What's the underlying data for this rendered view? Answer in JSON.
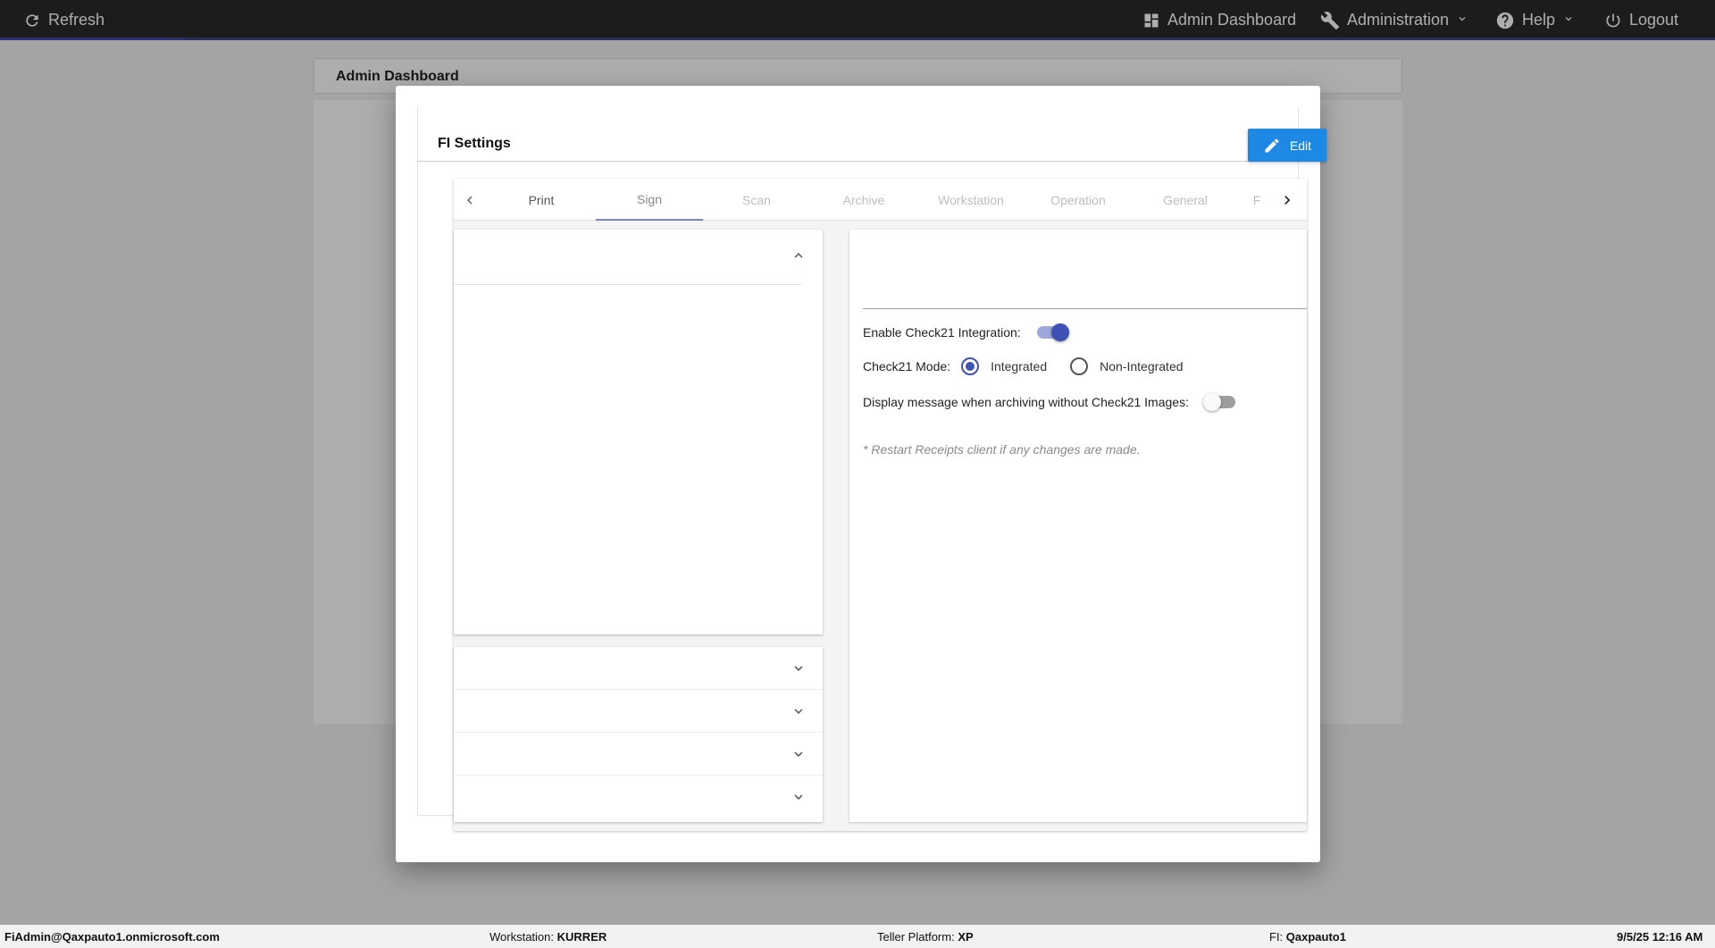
{
  "topbar": {
    "refresh_label": "Refresh",
    "admin_dashboard_label": "Admin Dashboard",
    "administration_label": "Administration",
    "help_label": "Help",
    "logout_label": "Logout"
  },
  "background": {
    "card_title": "Admin Dashboard"
  },
  "modal": {
    "title": "FI Settings",
    "edit_label": "Edit",
    "tabs": [
      {
        "label": "Print",
        "state": "enabled"
      },
      {
        "label": "Sign",
        "state": "active"
      },
      {
        "label": "Scan",
        "state": "disabled"
      },
      {
        "label": "Archive",
        "state": "disabled"
      },
      {
        "label": "Workstation",
        "state": "disabled"
      },
      {
        "label": "Operation",
        "state": "disabled"
      },
      {
        "label": "General",
        "state": "disabled"
      },
      {
        "label": "F",
        "state": "disabled"
      }
    ],
    "settings": {
      "enable_check21_label": "Enable Check21 Integration:",
      "enable_check21_value": true,
      "check21_mode_label": "Check21 Mode:",
      "mode_options": [
        "Integrated",
        "Non-Integrated"
      ],
      "mode_selected": "Integrated",
      "display_message_label": "Display message when archiving without Check21 Images:",
      "display_message_value": false,
      "restart_note": "* Restart Receipts client if any changes are made."
    }
  },
  "footer": {
    "user": "FiAdmin@Qaxpauto1.onmicrosoft.com",
    "workstation_label": "Workstation:",
    "workstation_value": "KURRER",
    "platform_label": "Teller Platform:",
    "platform_value": "XP",
    "fi_label": "FI:",
    "fi_value": "Qaxpauto1",
    "datetime": "9/5/25 12:16 AM"
  },
  "colors": {
    "topbar_bg": "#2a2a2a",
    "accent": "#3f51b5",
    "edit_button": "#1e88e5",
    "tab_enabled": "#555555",
    "tab_disabled": "#bdbdbd"
  }
}
